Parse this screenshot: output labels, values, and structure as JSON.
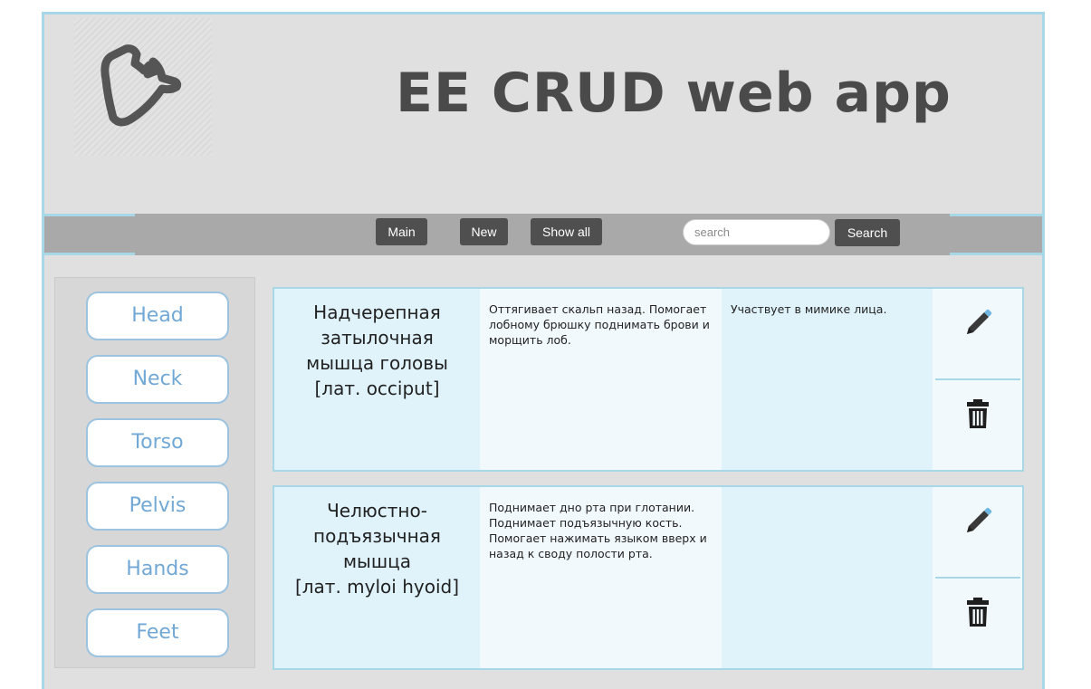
{
  "header": {
    "app_title": "EE CRUD web app",
    "logo_icon": "flexed-arm-icon"
  },
  "nav": {
    "main_label": "Main",
    "new_label": "New",
    "show_all_label": "Show all",
    "search_placeholder": "search",
    "search_button_label": "Search"
  },
  "sidebar": {
    "items": [
      {
        "label": "Head"
      },
      {
        "label": "Neck"
      },
      {
        "label": "Torso"
      },
      {
        "label": "Pelvis"
      },
      {
        "label": "Hands"
      },
      {
        "label": "Feet"
      }
    ]
  },
  "records": [
    {
      "name_lines": [
        "Надчерепная",
        "затылочная",
        "мышца головы",
        "[лат. occiput]"
      ],
      "function": "Оттягивает скальп назад. Помогает лобному брюшку поднимать брови и морщить лоб.",
      "extra": "Участвует в мимике лица.",
      "edit_icon": "pencil-icon",
      "delete_icon": "trash-icon"
    },
    {
      "name_lines": [
        "Челюстно-",
        "подъязычная",
        "мышца",
        "[лат. myloi hyoid]"
      ],
      "function": "Поднимает дно рта при глотании. Поднимает подъязычную кость. Помогает нажимать языком вверх и назад к своду полости рта.",
      "extra": "",
      "edit_icon": "pencil-icon",
      "delete_icon": "trash-icon"
    }
  ],
  "colors": {
    "accent_border": "#a8d7e8",
    "nav_button": "#4f4f4f",
    "sidebar_text": "#72a8d5",
    "title_text": "#4a4a4a"
  }
}
